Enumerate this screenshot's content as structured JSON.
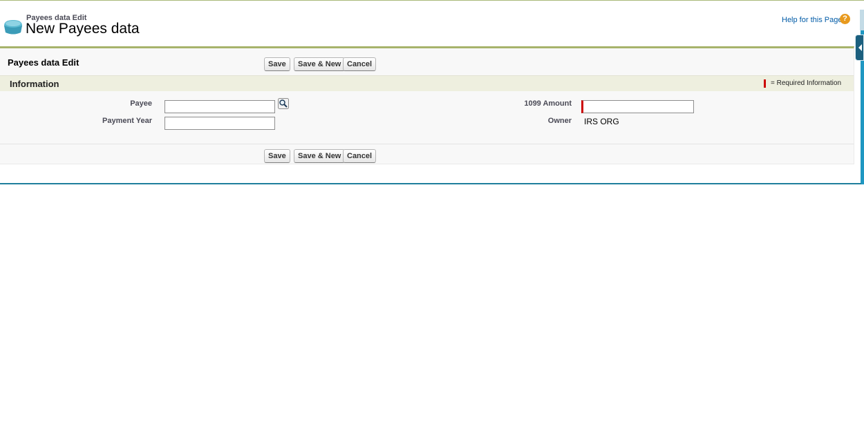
{
  "header": {
    "subtitle": "Payees data Edit",
    "title": "New Payees data",
    "help_link": "Help for this Page",
    "help_icon": "?"
  },
  "block": {
    "title": "Payees data Edit",
    "buttons": {
      "save": "Save",
      "save_new": "Save & New",
      "cancel": "Cancel"
    }
  },
  "section": {
    "title": "Information",
    "required_legend": "= Required Information"
  },
  "fields": {
    "payee": {
      "label": "Payee",
      "value": ""
    },
    "payment_year": {
      "label": "Payment Year",
      "value": ""
    },
    "amount_1099": {
      "label": "1099 Amount",
      "value": ""
    },
    "owner": {
      "label": "Owner",
      "value": "IRS ORG"
    }
  },
  "colors": {
    "accent_olive": "#a7b36b",
    "link_blue": "#015ba7",
    "required_red": "#cc0000",
    "teal": "#1f7e9c"
  }
}
